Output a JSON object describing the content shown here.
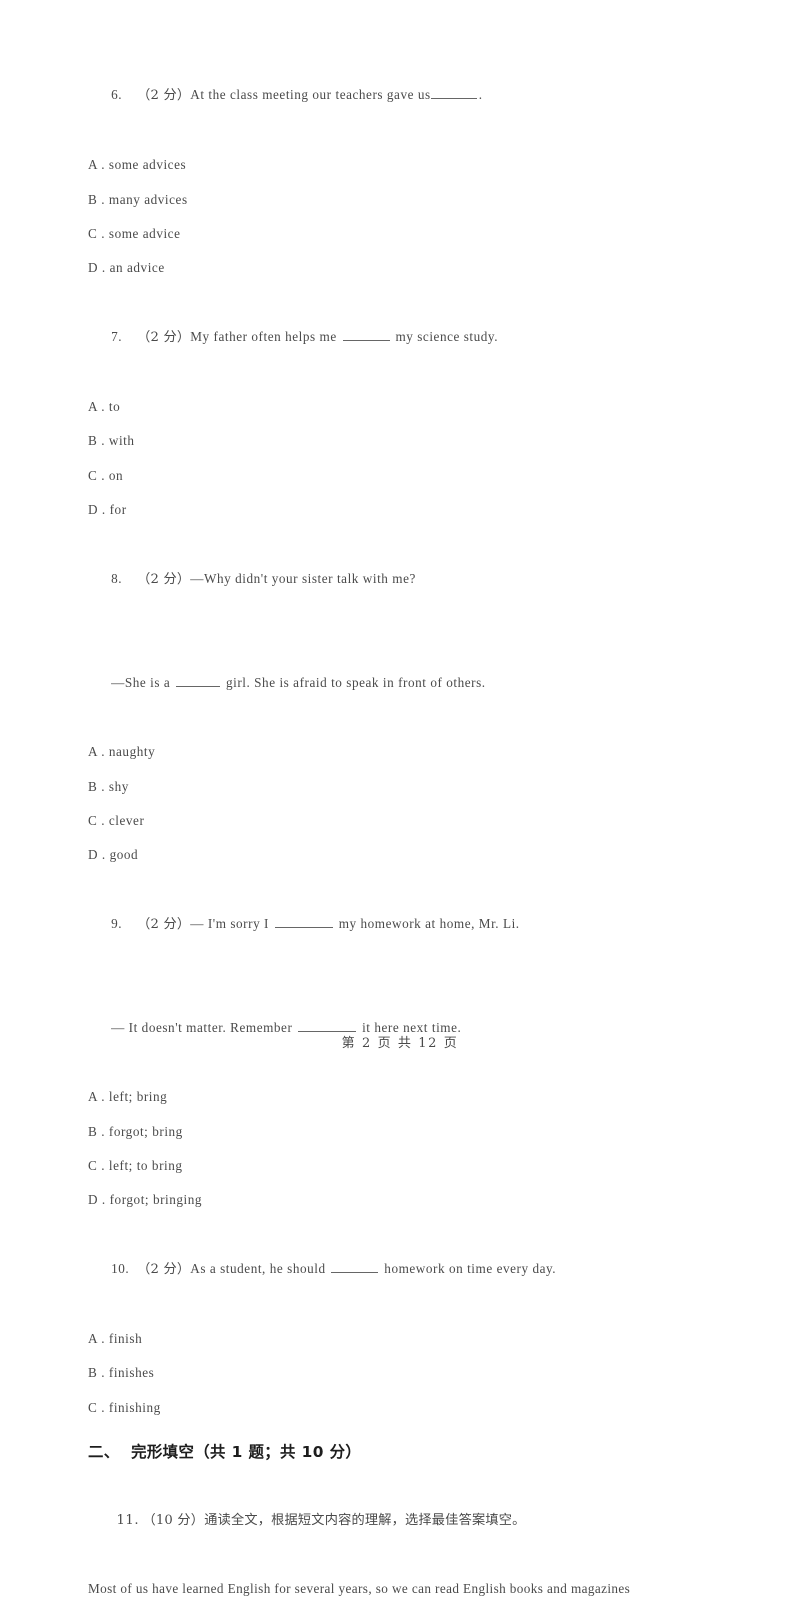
{
  "document": {
    "type": "exam-paper",
    "page_background": "#ffffff",
    "text_color": "#4a4a4a",
    "heading_color": "#1d1d1d"
  },
  "questions": [
    {
      "number": "6.",
      "points": "（2 分）",
      "stem_before": "At the class meeting our teachers gave us",
      "blank": "tight",
      "stem_after": ".",
      "options": [
        "A . some advices",
        "B . many advices",
        "C . some advice",
        "D . an advice"
      ]
    },
    {
      "number": "7.",
      "points": "（2 分）",
      "stem_before": "My father often helps me ",
      "blank": "mid",
      "stem_after": " my science study.",
      "options": [
        "A . to",
        "B . with",
        "C . on",
        "D . for"
      ]
    },
    {
      "number": "8.",
      "points": "（2 分）",
      "stem_before": "—Why didn't your sister talk with me?",
      "blank": "none",
      "stem_after": "",
      "continuation_before": "—She is a ",
      "continuation_blank": "short",
      "continuation_after": " girl. She is afraid to speak in front of others.",
      "options": [
        "A . naughty",
        "B . shy",
        "C . clever",
        "D . good"
      ]
    },
    {
      "number": "9.",
      "points": "（2 分）",
      "stem_before": "— I'm sorry I ",
      "blank": "long",
      "stem_after": " my homework at home, Mr. Li.",
      "continuation_before": "— It doesn't matter. Remember ",
      "continuation_blank": "long",
      "continuation_after": " it here next time.",
      "options": [
        "A . left; bring",
        "B . forgot; bring",
        "C . left; to bring",
        "D . forgot; bringing"
      ]
    },
    {
      "number": "10.",
      "points": "（2 分）",
      "stem_before": "As a student, he should ",
      "blank": "mid",
      "stem_after": " homework on time every day.",
      "options": [
        "A . finish",
        "B . finishes",
        "C . finishing"
      ]
    }
  ],
  "section": {
    "heading": "二、  完形填空（共 1 题；共 10 分）",
    "item_number": "11.",
    "item_points": "（10 分）",
    "item_instruction": "通读全文，根据短文内容的理解，选择最佳答案填空。",
    "passage_line": "Most of us have learned English for several years, so we can read English books and magazines"
  },
  "footer": {
    "text": "第 2 页 共 12 页",
    "current_page": "2",
    "total_pages": "12"
  }
}
